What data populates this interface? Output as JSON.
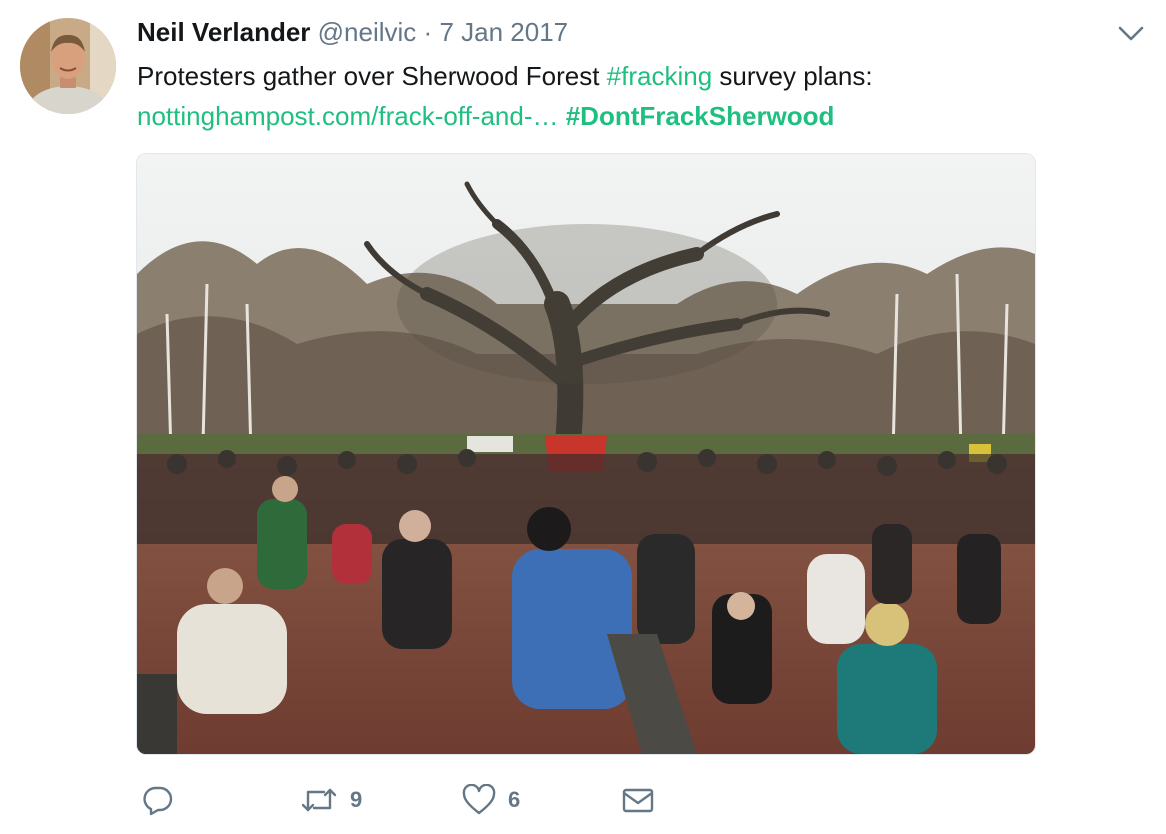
{
  "tweet": {
    "author_name": "Neil Verlander",
    "author_handle": "@neilvic",
    "separator": "·",
    "date": "7 Jan 2017",
    "text_part1": "Protesters gather over Sherwood Forest ",
    "hashtag1": "#fracking",
    "text_part2": " survey plans:",
    "link": "nottinghampost.com/frack-off-and-…",
    "hashtag2": "#DontFrackSherwood"
  },
  "actions": {
    "reply_icon": "reply-icon",
    "retweet_icon": "retweet-icon",
    "retweet_count": "9",
    "like_icon": "heart-icon",
    "like_count": "6",
    "message_icon": "envelope-icon"
  },
  "colors": {
    "link": "#1fbf80",
    "muted": "#657786",
    "text": "#14171a"
  }
}
